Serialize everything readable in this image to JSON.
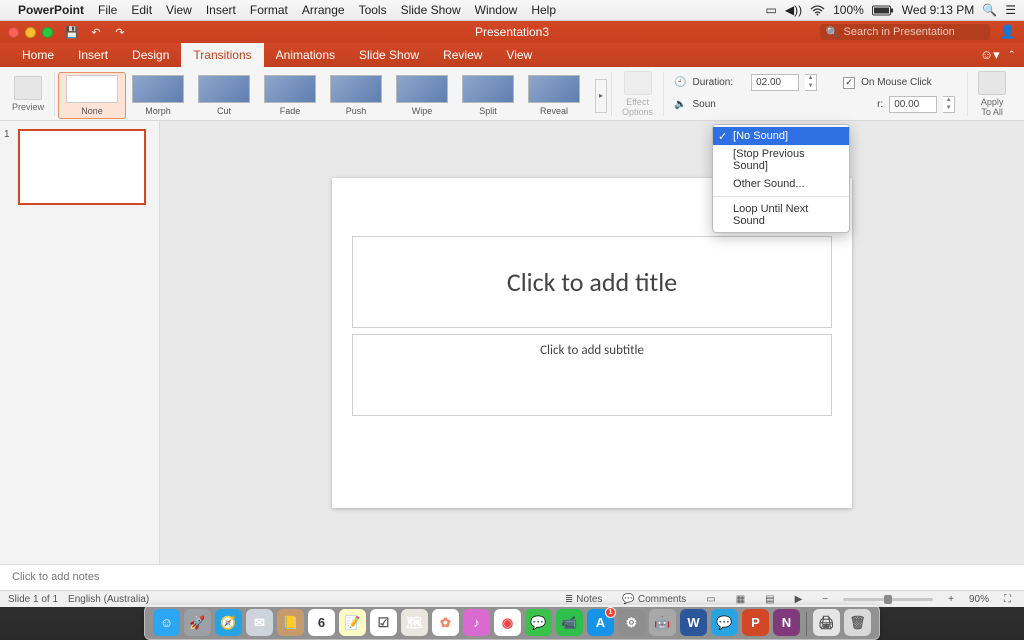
{
  "menubar": {
    "app": "PowerPoint",
    "items": [
      "File",
      "Edit",
      "View",
      "Insert",
      "Format",
      "Arrange",
      "Tools",
      "Slide Show",
      "Window",
      "Help"
    ],
    "battery": "100%",
    "clock": "Wed 9:13 PM"
  },
  "titlebar": {
    "doc": "Presentation3",
    "search_placeholder": "Search in Presentation"
  },
  "tabs": [
    "Home",
    "Insert",
    "Design",
    "Transitions",
    "Animations",
    "Slide Show",
    "Review",
    "View"
  ],
  "active_tab": "Transitions",
  "ribbon": {
    "preview": "Preview",
    "effect_options": "Effect\nOptions",
    "apply_to_all": "Apply\nTo All",
    "transitions": [
      {
        "label": "None",
        "blank": true,
        "selected": true
      },
      {
        "label": "Morph"
      },
      {
        "label": "Cut"
      },
      {
        "label": "Fade"
      },
      {
        "label": "Push"
      },
      {
        "label": "Wipe"
      },
      {
        "label": "Split"
      },
      {
        "label": "Reveal"
      }
    ],
    "duration_label": "Duration:",
    "duration_value": "02.00",
    "on_mouse_click": "On Mouse Click",
    "sound_label": "Soun",
    "after_label": "r:",
    "after_value": "00.00",
    "sound_menu": {
      "no_sound": "[No Sound]",
      "stop_previous": "[Stop Previous Sound]",
      "other": "Other Sound...",
      "loop": "Loop Until Next Sound"
    }
  },
  "slide": {
    "title_ph": "Click to add title",
    "subtitle_ph": "Click to add subtitle"
  },
  "notes_ph": "Click to add notes",
  "status": {
    "slide": "Slide 1 of 1",
    "lang": "English (Australia)",
    "notes": "Notes",
    "comments": "Comments",
    "zoom": "90%"
  },
  "thumb_num": "1",
  "dock": [
    {
      "name": "finder",
      "bg": "#2aa6f2",
      "txt": "☺"
    },
    {
      "name": "launchpad",
      "bg": "#9aa0a6",
      "txt": "🚀"
    },
    {
      "name": "safari",
      "bg": "#27a3e3",
      "txt": "🧭"
    },
    {
      "name": "mail",
      "bg": "#cdd4db",
      "txt": "✉"
    },
    {
      "name": "contacts",
      "bg": "#c79a6b",
      "txt": "📒"
    },
    {
      "name": "calendar",
      "bg": "#ffffff",
      "txt": "6",
      "fg": "#333"
    },
    {
      "name": "notes",
      "bg": "#fff9c5",
      "txt": "📝"
    },
    {
      "name": "reminders",
      "bg": "#ffffff",
      "txt": "☑",
      "fg": "#555"
    },
    {
      "name": "maps",
      "bg": "#e9e6df",
      "txt": "🗺"
    },
    {
      "name": "photos",
      "bg": "#ffffff",
      "txt": "✿",
      "fg": "#e86"
    },
    {
      "name": "itunes",
      "bg": "#d96bd0",
      "txt": "♪"
    },
    {
      "name": "chrome",
      "bg": "#ffffff",
      "txt": "◉",
      "fg": "#e44"
    },
    {
      "name": "messages",
      "bg": "#3ac24a",
      "txt": "💬"
    },
    {
      "name": "facetime",
      "bg": "#2fbf4b",
      "txt": "📹"
    },
    {
      "name": "appstore",
      "bg": "#1793e8",
      "txt": "A",
      "badge": "1"
    },
    {
      "name": "sysprefs",
      "bg": "#8e8e8e",
      "txt": "⚙"
    },
    {
      "name": "automator",
      "bg": "#a8a8a8",
      "txt": "🤖"
    },
    {
      "name": "word",
      "bg": "#2b579a",
      "txt": "W"
    },
    {
      "name": "skype",
      "bg": "#29a4e2",
      "txt": "💬"
    },
    {
      "name": "powerpoint",
      "bg": "#d24726",
      "txt": "P"
    },
    {
      "name": "onenote",
      "bg": "#80397b",
      "txt": "N"
    }
  ],
  "dock_right": [
    {
      "name": "printer",
      "bg": "#e5e5e5",
      "txt": "🖨",
      "fg": "#555"
    },
    {
      "name": "trash",
      "bg": "#d9d9d9",
      "txt": "🗑",
      "fg": "#666"
    }
  ]
}
